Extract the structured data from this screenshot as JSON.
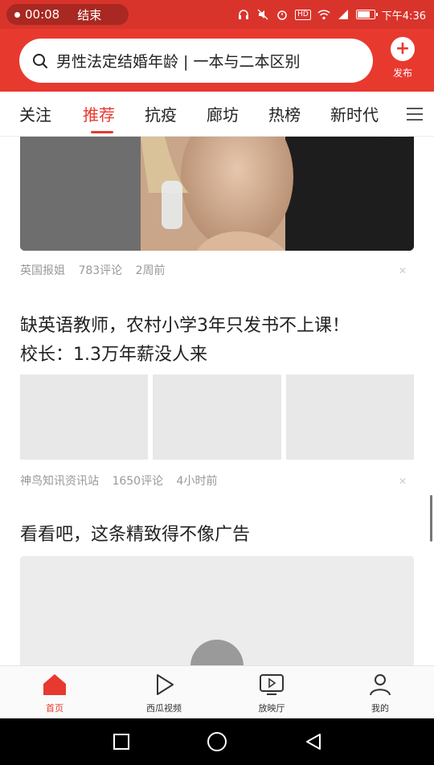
{
  "status": {
    "time": "00:08",
    "end_label": "结束",
    "clock": "下午4:36"
  },
  "header": {
    "search_text": "男性法定结婚年龄 | 一本与二本区别",
    "publish_label": "发布"
  },
  "tabs": [
    {
      "label": "关注",
      "active": false
    },
    {
      "label": "推荐",
      "active": true
    },
    {
      "label": "抗疫",
      "active": false
    },
    {
      "label": "廊坊",
      "active": false
    },
    {
      "label": "热榜",
      "active": false
    },
    {
      "label": "新时代",
      "active": false
    }
  ],
  "feed": {
    "article1": {
      "source": "英国报姐",
      "comments": "783评论",
      "time": "2周前"
    },
    "article2": {
      "title_line1": "缺英语教师，农村小学3年只发书不上课！",
      "title_line2": "校长：1.3万年薪没人来",
      "source": "神鸟知讯资讯站",
      "comments": "1650评论",
      "time": "4小时前"
    },
    "ad": {
      "title": "看看吧，这条精致得不像广告"
    }
  },
  "bottom_nav": [
    {
      "label": "首页",
      "icon": "home-icon",
      "active": true
    },
    {
      "label": "西瓜视频",
      "icon": "play-icon",
      "active": false
    },
    {
      "label": "放映厅",
      "icon": "tv-icon",
      "active": false
    },
    {
      "label": "我的",
      "icon": "user-icon",
      "active": false
    }
  ],
  "colors": {
    "brand_red": "#e8392f",
    "status_red": "#d9342b"
  }
}
